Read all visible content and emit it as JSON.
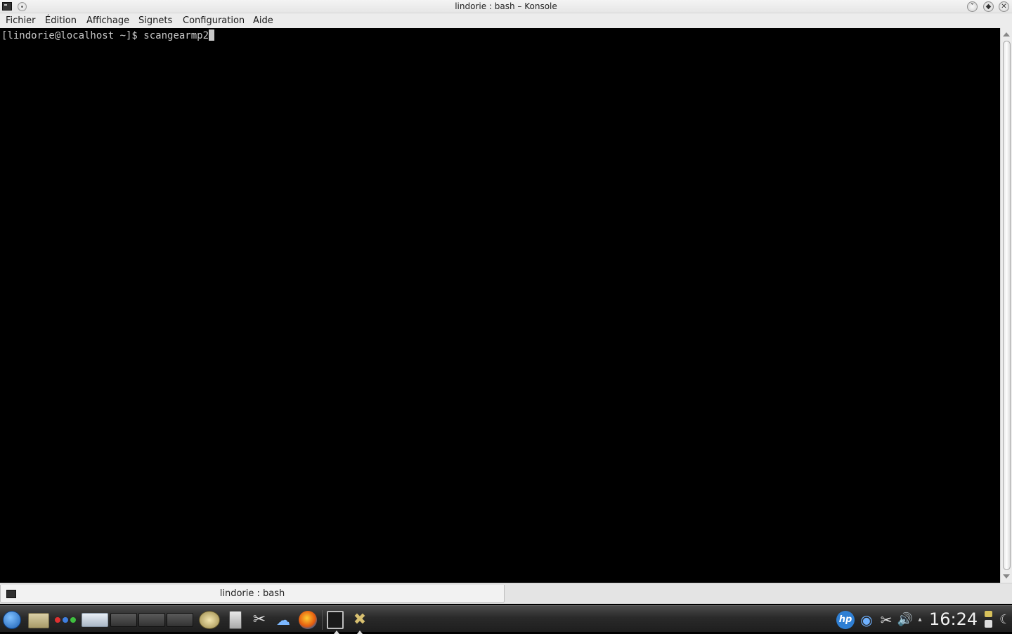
{
  "window": {
    "title": "lindorie : bash – Konsole",
    "minimize_glyph": "˅",
    "maximize_glyph": "◆",
    "close_glyph": "✕"
  },
  "menubar": {
    "items": [
      "Fichier",
      "Édition",
      "Affichage",
      "Signets",
      "Configuration",
      "Aide"
    ]
  },
  "terminal": {
    "prompt": "[lindorie@localhost ~]$ ",
    "command": "scangearmp2"
  },
  "tabs": [
    {
      "label": "lindorie : bash"
    }
  ],
  "panel": {
    "tray_hp_label": "hp",
    "clock": "16:24",
    "glyphs": {
      "tools": "✂",
      "network": "☁",
      "scangear": "✖",
      "tray_net": "◉",
      "tray_clip": "✂",
      "volume": "🔊",
      "tray_arrow": "▴",
      "moon": "☾"
    },
    "activity_colors": [
      "#e03030",
      "#3f7fe0",
      "#3fbf3f"
    ]
  }
}
